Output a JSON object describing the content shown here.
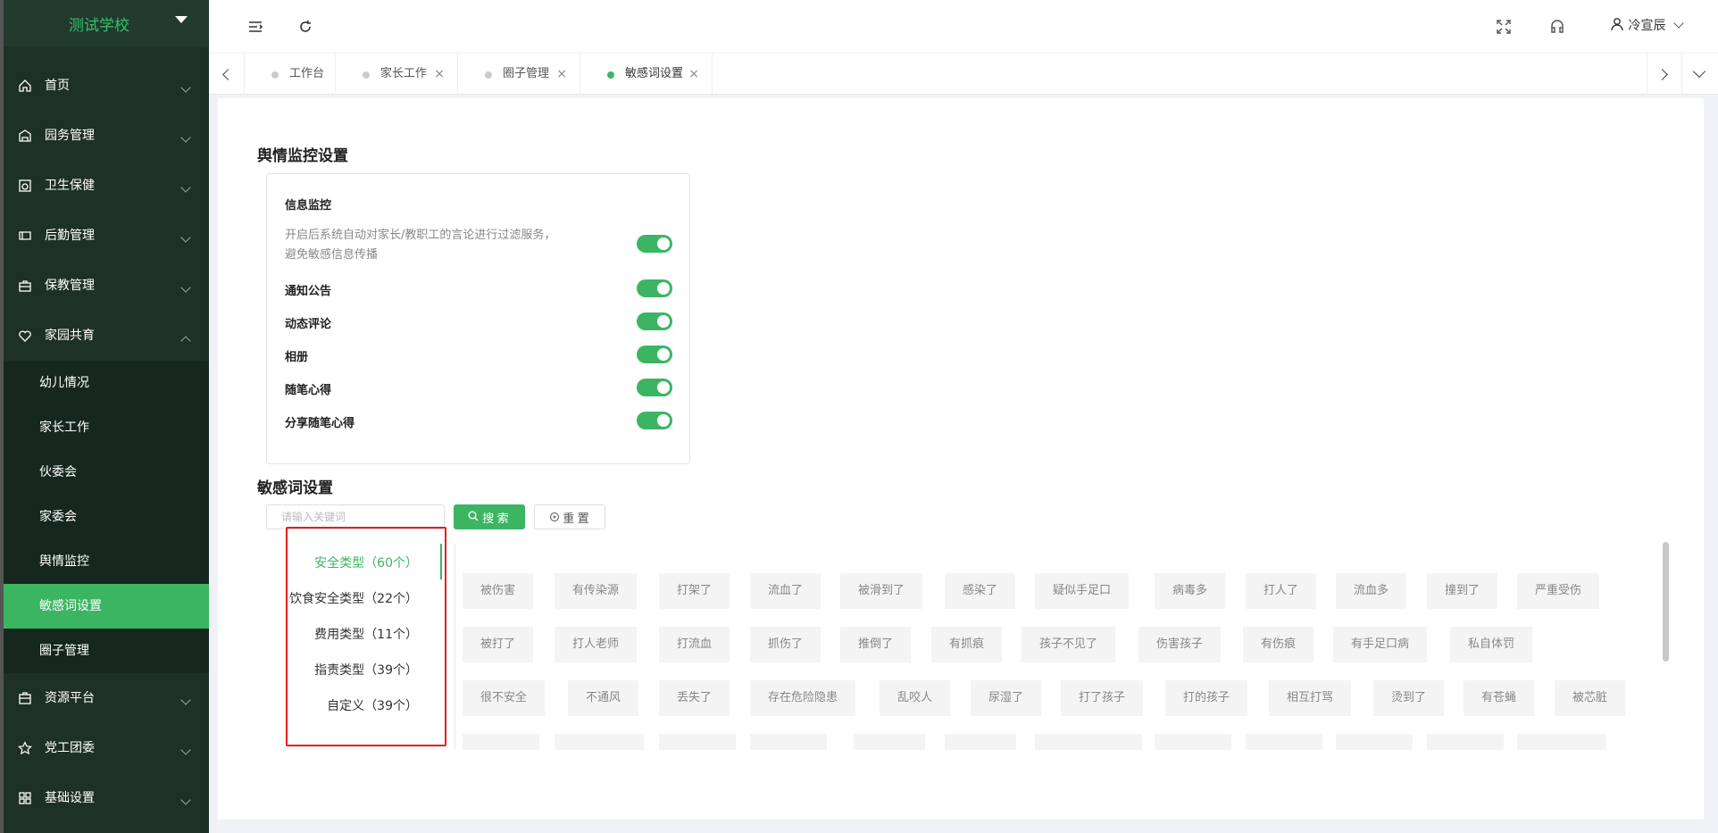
{
  "sidebar": {
    "school": "测试学校",
    "menu": [
      {
        "label": "首页",
        "icon": "home-icon"
      },
      {
        "label": "园务管理",
        "icon": "building-icon"
      },
      {
        "label": "卫生保健",
        "icon": "health-icon"
      },
      {
        "label": "后勤管理",
        "icon": "logistics-icon"
      },
      {
        "label": "保教管理",
        "icon": "briefcase-icon"
      },
      {
        "label": "家园共育",
        "icon": "heart-icon"
      }
    ],
    "submenu": [
      "幼儿情况",
      "家长工作",
      "伙委会",
      "家委会",
      "舆情监控",
      "敏感词设置",
      "圈子管理"
    ],
    "menu_bottom": [
      {
        "label": "资源平台",
        "icon": "box-icon"
      },
      {
        "label": "党工团委",
        "icon": "star-icon"
      },
      {
        "label": "基础设置",
        "icon": "grid-icon"
      }
    ]
  },
  "header": {
    "user": "冷宣辰"
  },
  "tabs": [
    {
      "label": "工作台"
    },
    {
      "label": "家长工作"
    },
    {
      "label": "圈子管理"
    },
    {
      "label": "敏感词设置"
    }
  ],
  "monitor": {
    "title": "舆情监控设置",
    "info_label": "信息监控",
    "info_desc": "开启后系统自动对家长/教职工的言论进行过滤服务， 避免敏感信息传播",
    "items": [
      "通知公告",
      "动态评论",
      "相册",
      "随笔心得",
      "分享随笔心得"
    ]
  },
  "sensitive": {
    "title": "敏感词设置",
    "placeholder": "请输入关键词",
    "search_label": "搜 索",
    "reset_label": "重 置",
    "categories": [
      "安全类型（60个）",
      "饮食安全类型（22个）",
      "费用类型（11个）",
      "指责类型（39个）",
      "自定义（39个）"
    ],
    "words_row1": [
      "被伤害",
      "有传染源",
      "打架了",
      "流血了",
      "被滑到了",
      "感染了",
      "疑似手足口",
      "病毒多",
      "打人了",
      "流血多",
      "撞到了",
      "严重受伤"
    ],
    "words_row2": [
      "被打了",
      "打人老师",
      "打流血",
      "抓伤了",
      "推倒了",
      "有抓痕",
      "孩子不见了",
      "伤害孩子",
      "有伤痕",
      "有手足口病",
      "私自体罚"
    ],
    "words_row3": [
      "很不安全",
      "不通风",
      "丢失了",
      "存在危险隐患",
      "乱咬人",
      "尿湿了",
      "打了孩子",
      "打的孩子",
      "相互打骂",
      "烫到了",
      "有苍蝇",
      "被芯脏"
    ]
  }
}
